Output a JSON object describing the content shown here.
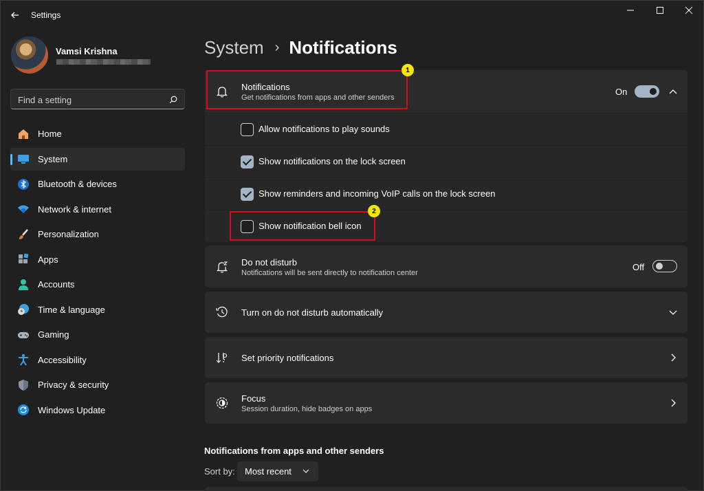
{
  "window": {
    "title": "Settings",
    "controls": [
      "minimize",
      "maximize",
      "close"
    ]
  },
  "profile": {
    "name": "Vamsi Krishna"
  },
  "search": {
    "placeholder": "Find a setting"
  },
  "sidebar": {
    "items": [
      {
        "label": "Home",
        "icon": "home-icon",
        "active": false
      },
      {
        "label": "System",
        "icon": "system-icon",
        "active": true
      },
      {
        "label": "Bluetooth & devices",
        "icon": "bluetooth-icon",
        "active": false
      },
      {
        "label": "Network & internet",
        "icon": "wifi-icon",
        "active": false
      },
      {
        "label": "Personalization",
        "icon": "brush-icon",
        "active": false
      },
      {
        "label": "Apps",
        "icon": "apps-icon",
        "active": false
      },
      {
        "label": "Accounts",
        "icon": "accounts-icon",
        "active": false
      },
      {
        "label": "Time & language",
        "icon": "clock-globe-icon",
        "active": false
      },
      {
        "label": "Gaming",
        "icon": "gamepad-icon",
        "active": false
      },
      {
        "label": "Accessibility",
        "icon": "accessibility-icon",
        "active": false
      },
      {
        "label": "Privacy & security",
        "icon": "shield-icon",
        "active": false
      },
      {
        "label": "Windows Update",
        "icon": "update-icon",
        "active": false
      }
    ]
  },
  "breadcrumb": {
    "parent": "System",
    "separator": "›",
    "current": "Notifications"
  },
  "notifications": {
    "title": "Notifications",
    "subtitle": "Get notifications from apps and other senders",
    "toggle_label": "On",
    "toggle_on": true,
    "options": [
      {
        "label": "Allow notifications to play sounds",
        "checked": false
      },
      {
        "label": "Show notifications on the lock screen",
        "checked": true
      },
      {
        "label": "Show reminders and incoming VoIP calls on the lock screen",
        "checked": true
      },
      {
        "label": "Show notification bell icon",
        "checked": false
      }
    ]
  },
  "dnd": {
    "title": "Do not disturb",
    "subtitle": "Notifications will be sent directly to notification center",
    "toggle_label": "Off",
    "toggle_on": false
  },
  "dnd_auto": {
    "title": "Turn on do not disturb automatically"
  },
  "priority": {
    "title": "Set priority notifications"
  },
  "focus": {
    "title": "Focus",
    "subtitle": "Session duration, hide badges on apps"
  },
  "apps_section": {
    "heading": "Notifications from apps and other senders",
    "sort_label": "Sort by:",
    "sort_value": "Most recent"
  },
  "annotations": [
    {
      "number": "1"
    },
    {
      "number": "2"
    }
  ],
  "colors": {
    "accent": "#4cc2ff",
    "toggle_on": "#a3b4c6",
    "annotation_box": "#d90b17",
    "annotation_badge": "#f4e800",
    "background": "#202020",
    "card": "#2b2b2b"
  }
}
